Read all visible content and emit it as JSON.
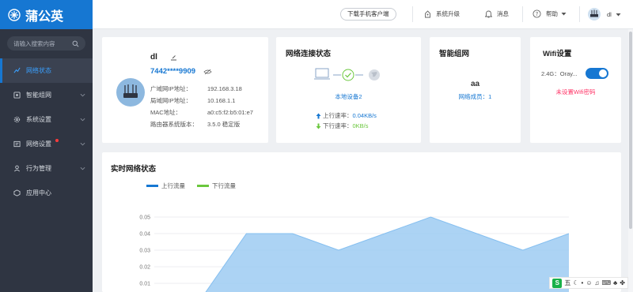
{
  "app": {
    "name": "蒲公英"
  },
  "search": {
    "placeholder": "请输入搜索内容"
  },
  "sidebar": {
    "items": [
      {
        "label": "网络状态",
        "active": true,
        "has_chevron": false,
        "icon": "network-status-icon"
      },
      {
        "label": "智能组网",
        "has_chevron": true,
        "icon": "smart-network-icon"
      },
      {
        "label": "系统设置",
        "has_chevron": true,
        "icon": "gear-icon"
      },
      {
        "label": "网络设置",
        "has_chevron": true,
        "has_dot": true,
        "icon": "network-settings-icon"
      },
      {
        "label": "行为管理",
        "has_chevron": true,
        "icon": "behavior-icon"
      },
      {
        "label": "应用中心",
        "has_chevron": false,
        "icon": "app-center-icon"
      }
    ]
  },
  "header": {
    "download_label": "下载手机客户端",
    "upgrade_label": "系统升级",
    "messages_label": "消息",
    "help_label": "帮助",
    "user_label": "dl"
  },
  "device": {
    "name": "dl",
    "sn": "7442****9909",
    "rows": [
      {
        "k": "广域网IP地址：",
        "v": "192.168.3.18"
      },
      {
        "k": "局域网IP地址：",
        "v": "10.168.1.1"
      },
      {
        "k": "MAC地址：",
        "v": "a0:c5:f2:b5:01:e7"
      },
      {
        "k": "路由器系统版本：",
        "v": "3.5.0 稳定版"
      }
    ]
  },
  "connection": {
    "title": "网络连接状态",
    "local_device": "本地设备2",
    "upload_label": "上行速率：",
    "upload_value": "0.04KB/s",
    "download_label": "下行速率：",
    "download_value": "0KB/s"
  },
  "smart_network": {
    "title": "智能组网",
    "name": "aa",
    "members_label": "网络成员：1"
  },
  "wifi": {
    "title": "Wifi设置",
    "band_label": "2.4G：Oray...",
    "warning": "未设置Wifi密码",
    "enabled": true
  },
  "realtime": {
    "title": "实时网络状态"
  },
  "ime": {
    "text": "五"
  },
  "colors": {
    "primary": "#1677d2",
    "sidebar": "#2f3542",
    "upload": "#1677d2",
    "download": "#6ac73d",
    "warning": "#ff3366"
  },
  "chart_data": {
    "type": "area",
    "series": [
      {
        "name": "上行流量",
        "color": "#1677d2",
        "values": [
          0,
          0,
          0.04,
          0.04,
          0.03,
          0.04,
          0.05,
          0.04,
          0.03,
          0.04
        ]
      },
      {
        "name": "下行流量",
        "color": "#6ac73d",
        "values": [
          0,
          0,
          0,
          0,
          0,
          0,
          0,
          0,
          0,
          0
        ]
      }
    ],
    "y_ticks": [
      "0.05",
      "0.04",
      "0.03",
      "0.02",
      "0.01"
    ],
    "ylim": [
      0,
      0.05
    ],
    "grid": true,
    "legend": "top-left"
  }
}
